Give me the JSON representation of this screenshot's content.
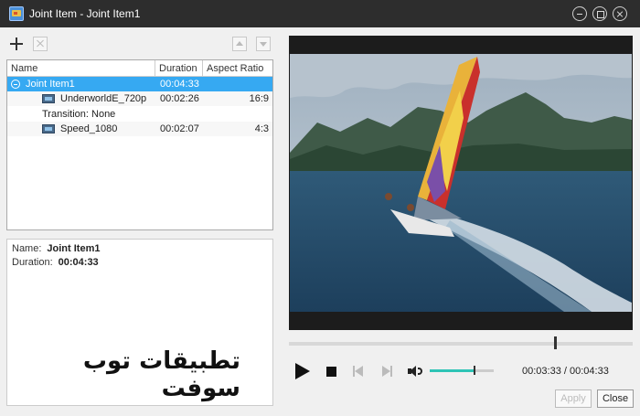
{
  "window": {
    "title": "Joint Item - Joint Item1"
  },
  "list": {
    "headers": {
      "name": "Name",
      "duration": "Duration",
      "aspect_ratio": "Aspect Ratio"
    },
    "rows": [
      {
        "name": "Joint Item1",
        "duration": "00:04:33",
        "aspect": ""
      },
      {
        "name": "UnderworldE_720p",
        "duration": "00:02:26",
        "aspect": "16:9"
      },
      {
        "name": "Transition: None",
        "duration": "",
        "aspect": ""
      },
      {
        "name": "Speed_1080",
        "duration": "00:02:07",
        "aspect": "4:3"
      }
    ]
  },
  "info": {
    "name_label": "Name:",
    "name_value": "Joint Item1",
    "duration_label": "Duration:",
    "duration_value": "00:04:33"
  },
  "watermark": "تطبيقات توب سوفت",
  "player": {
    "time": "00:03:33 / 00:04:33",
    "volume": 0.68,
    "progress": 0.78
  },
  "buttons": {
    "apply": "Apply",
    "close": "Close"
  },
  "colors": {
    "selection": "#36a9f2",
    "volume": "#2ec4b6",
    "titlebar": "#2d2d2d"
  }
}
